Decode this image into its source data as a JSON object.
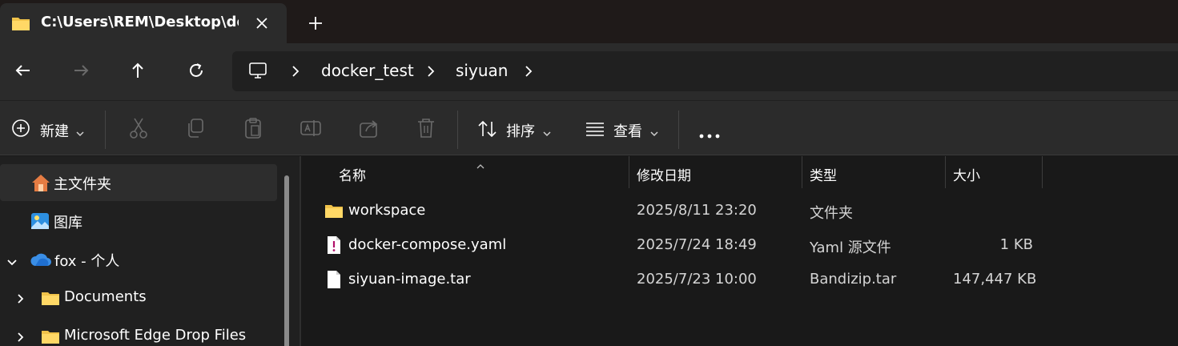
{
  "tab": {
    "title": "C:\\Users\\REM\\Desktop\\docker_test\\siyuan",
    "close_glyph": "✕",
    "new_tab_glyph": "+"
  },
  "nav": {
    "back_glyph": "←",
    "forward_glyph": "→",
    "up_glyph": "↑",
    "refresh_glyph": "⟳"
  },
  "breadcrumb": {
    "items": [
      "docker_test",
      "siyuan"
    ],
    "separator": "›"
  },
  "toolbar": {
    "new_label": "新建",
    "sort_label": "排序",
    "view_label": "查看",
    "more_glyph": "•••"
  },
  "sidebar": {
    "items": [
      {
        "label": "主文件夹",
        "icon": "home-icon",
        "selected": true
      },
      {
        "label": "图库",
        "icon": "gallery-icon"
      },
      {
        "label": "fox - 个人",
        "icon": "onedrive-cloud-icon",
        "expanded": true
      },
      {
        "label": "Documents",
        "icon": "folder-icon",
        "expandable": true
      },
      {
        "label": "Microsoft Edge Drop Files",
        "icon": "folder-icon",
        "expandable": true
      }
    ]
  },
  "columns": {
    "name": "名称",
    "modified": "修改日期",
    "type": "类型",
    "size": "大小"
  },
  "files": [
    {
      "name": "workspace",
      "modified": "2025/8/11 23:20",
      "type": "文件夹",
      "size": "",
      "icon": "folder-icon"
    },
    {
      "name": "docker-compose.yaml",
      "modified": "2025/7/24 18:49",
      "type": "Yaml 源文件",
      "size": "1 KB",
      "icon": "yaml-file-icon"
    },
    {
      "name": "siyuan-image.tar",
      "modified": "2025/7/23 10:00",
      "type": "Bandizip.tar",
      "size": "147,447 KB",
      "icon": "file-icon"
    }
  ],
  "colors": {
    "accent_folder": "#f0c24a",
    "background": "#191919",
    "panel": "#2b2b2b"
  }
}
